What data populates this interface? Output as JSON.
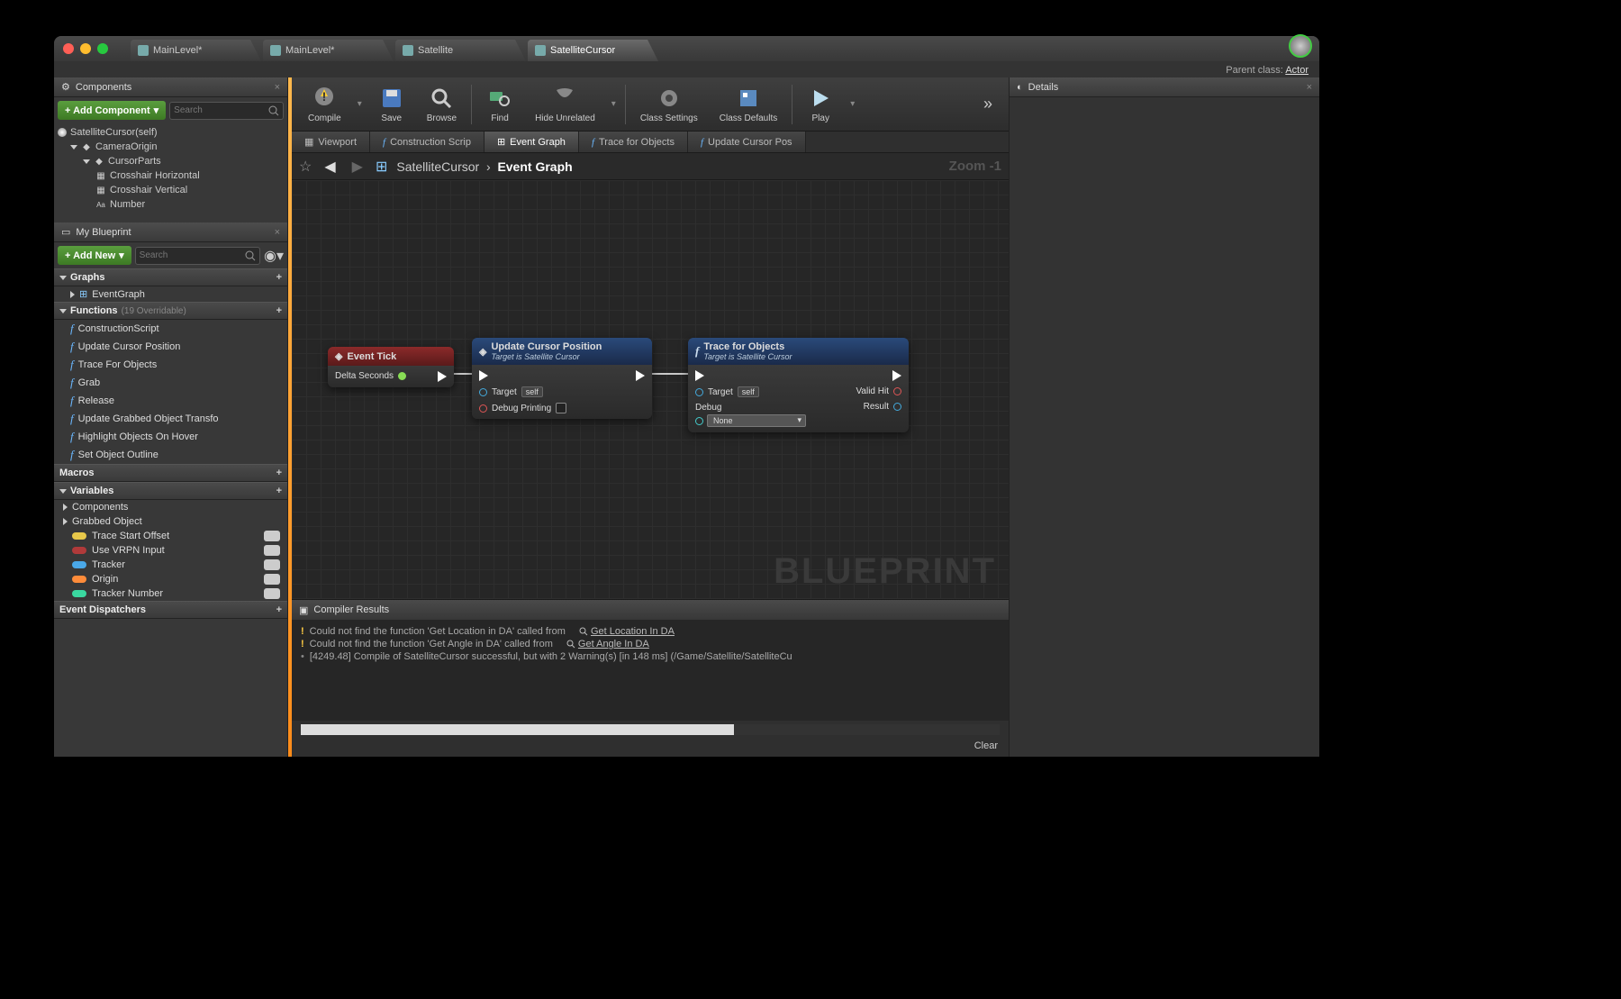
{
  "parent_class_label": "Parent class:",
  "parent_class_value": "Actor",
  "tabs": [
    {
      "label": "MainLevel*"
    },
    {
      "label": "MainLevel*"
    },
    {
      "label": "Satellite"
    },
    {
      "label": "SatelliteCursor"
    }
  ],
  "panels": {
    "components": {
      "title": "Components",
      "add_button": "+ Add Component",
      "search_placeholder": "Search",
      "root": "SatelliteCursor(self)",
      "tree": [
        {
          "label": "CameraOrigin",
          "indent": 1
        },
        {
          "label": "CursorParts",
          "indent": 2
        },
        {
          "label": "Crosshair Horizontal",
          "indent": 3
        },
        {
          "label": "Crosshair Vertical",
          "indent": 3
        },
        {
          "label": "Number",
          "indent": 3
        }
      ]
    },
    "myblueprint": {
      "title": "My Blueprint",
      "add_button": "+ Add New",
      "search_placeholder": "Search",
      "sections": {
        "graphs": {
          "label": "Graphs",
          "items": [
            "EventGraph"
          ]
        },
        "functions": {
          "label": "Functions",
          "note": "(19 Overridable)",
          "items": [
            "ConstructionScript",
            "Update Cursor Position",
            "Trace For Objects",
            "Grab",
            "Release",
            "Update Grabbed Object Transfo",
            "Highlight Objects On Hover",
            "Set Object Outline"
          ]
        },
        "macros": {
          "label": "Macros"
        },
        "variables": {
          "label": "Variables",
          "groups": [
            "Components",
            "Grabbed Object"
          ],
          "items": [
            {
              "label": "Trace Start Offset",
              "color": "#e8c84a"
            },
            {
              "label": "Use VRPN Input",
              "color": "#b03a3a"
            },
            {
              "label": "Tracker",
              "color": "#4aa8e8"
            },
            {
              "label": "Origin",
              "color": "#ff8c3a"
            },
            {
              "label": "Tracker Number",
              "color": "#3ad8a0"
            }
          ]
        },
        "dispatchers": {
          "label": "Event Dispatchers"
        }
      }
    },
    "details": {
      "title": "Details"
    }
  },
  "toolbar": [
    {
      "label": "Compile",
      "chev": true
    },
    {
      "label": "Save"
    },
    {
      "label": "Browse"
    },
    {
      "sep": true
    },
    {
      "label": "Find"
    },
    {
      "label": "Hide Unrelated",
      "chev": true
    },
    {
      "sep": true
    },
    {
      "label": "Class Settings"
    },
    {
      "label": "Class Defaults"
    },
    {
      "sep": true
    },
    {
      "label": "Play",
      "chev": true
    }
  ],
  "graph_tabs": [
    {
      "label": "Viewport",
      "type": "vp"
    },
    {
      "label": "Construction Scrip",
      "type": "fn"
    },
    {
      "label": "Event Graph",
      "type": "g",
      "active": true
    },
    {
      "label": "Trace for Objects",
      "type": "fn"
    },
    {
      "label": "Update Cursor Pos",
      "type": "fn"
    }
  ],
  "breadcrumb": {
    "root": "SatelliteCursor",
    "leaf": "Event Graph"
  },
  "zoom": "Zoom -1",
  "watermark": "BLUEPRINT",
  "nodes": {
    "event": {
      "title": "Event Tick",
      "pin": "Delta Seconds"
    },
    "update": {
      "title": "Update Cursor Position",
      "sub": "Target is Satellite Cursor",
      "target": "Target",
      "self": "self",
      "debug": "Debug Printing"
    },
    "trace": {
      "title": "Trace for Objects",
      "sub": "Target is Satellite Cursor",
      "target": "Target",
      "self": "self",
      "debug": "Debug",
      "combo": "None",
      "out1": "Valid Hit",
      "out2": "Result"
    }
  },
  "compiler": {
    "title": "Compiler Results",
    "lines": [
      {
        "t": "warn",
        "text": "Could not find the function 'Get Location in DA' called from",
        "link": "Get Location In DA"
      },
      {
        "t": "warn",
        "text": "Could not find the function 'Get Angle in DA' called from",
        "link": "Get Angle In DA"
      },
      {
        "t": "info",
        "text": "[4249.48] Compile of SatelliteCursor successful, but with 2 Warning(s) [in 148 ms] (/Game/Satellite/SatelliteCu"
      }
    ],
    "clear": "Clear"
  }
}
